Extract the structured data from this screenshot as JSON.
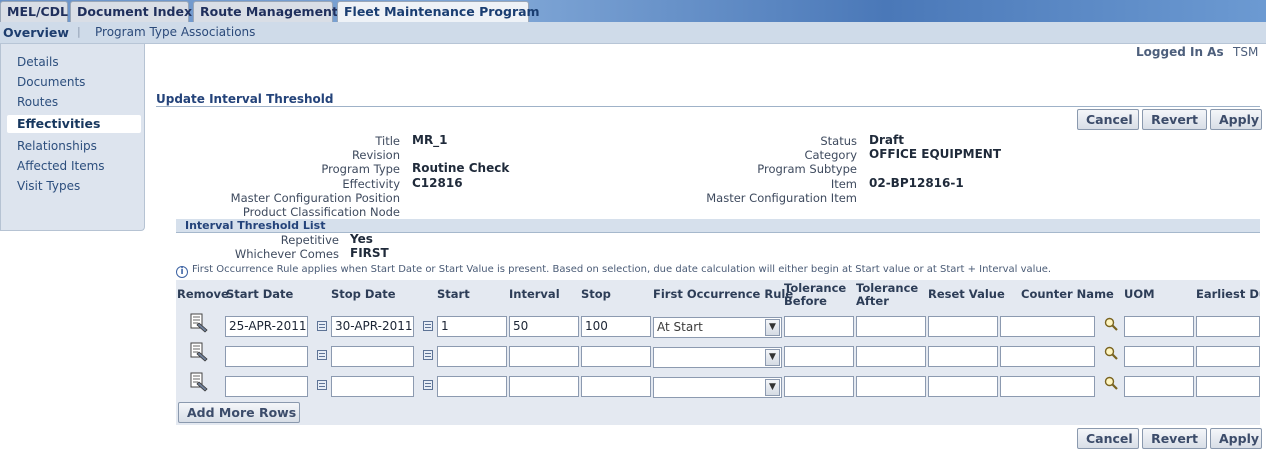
{
  "tabs": [
    {
      "label": "MEL/CDL"
    },
    {
      "label": "Document Index"
    },
    {
      "label": "Route Management"
    },
    {
      "label": "Fleet Maintenance Program"
    }
  ],
  "subtabs": [
    {
      "label": "Overview"
    },
    {
      "label": "Program Type Associations"
    }
  ],
  "sidebar": {
    "items": [
      {
        "label": "Details"
      },
      {
        "label": "Documents"
      },
      {
        "label": "Routes"
      },
      {
        "label": "Effectivities"
      },
      {
        "label": "Relationships"
      },
      {
        "label": "Affected Items"
      },
      {
        "label": "Visit Types"
      }
    ]
  },
  "user": {
    "logged_in_label": "Logged In As",
    "name": "TSM"
  },
  "page": {
    "title": "Update Interval Threshold"
  },
  "buttons": {
    "cancel": "Cancel",
    "revert": "Revert",
    "apply": "Apply",
    "add_rows": "Add More Rows"
  },
  "header": {
    "title_label": "Title",
    "title_value": "MR_1",
    "revision_label": "Revision",
    "program_type_label": "Program Type",
    "program_type_value": "Routine Check",
    "effectivity_label": "Effectivity",
    "effectivity_value": "C12816",
    "master_config_position_label": "Master Configuration Position",
    "product_class_label": "Product Classification Node",
    "status_label": "Status",
    "status_value": "Draft",
    "category_label": "Category",
    "category_value": "OFFICE EQUIPMENT",
    "program_subtype_label": "Program Subtype",
    "item_label": "Item",
    "item_value": "02-BP12816-1",
    "master_config_item_label": "Master Configuration Item"
  },
  "threshold": {
    "section_title": "Interval Threshold List",
    "repetitive_label": "Repetitive",
    "repetitive_value": "Yes",
    "whichever_label": "Whichever Comes",
    "whichever_value": "FIRST",
    "info": "First Occurrence Rule applies when Start Date or Start Value is present. Based on selection, due date calculation will either begin at Start value or at Start + Interval value."
  },
  "table": {
    "columns": {
      "remove": "Remove",
      "start_date": "Start Date",
      "stop_date": "Stop Date",
      "start": "Start",
      "interval": "Interval",
      "stop": "Stop",
      "first_rule": "First Occurrence Rule",
      "tol_before_1": "Tolerance",
      "tol_before_2": "Before",
      "tol_after_1": "Tolerance",
      "tol_after_2": "After",
      "reset": "Reset Value",
      "counter": "Counter Name",
      "uom": "UOM",
      "earliest": "Earliest Due"
    },
    "rows": [
      {
        "start_date": "25-APR-2011",
        "stop_date": "30-APR-2011",
        "start": "1",
        "interval": "50",
        "stop": "100",
        "first_rule": "At Start"
      },
      {
        "start_date": "",
        "stop_date": "",
        "start": "",
        "interval": "",
        "stop": "",
        "first_rule": ""
      },
      {
        "start_date": "",
        "stop_date": "",
        "start": "",
        "interval": "",
        "stop": "",
        "first_rule": ""
      }
    ]
  }
}
